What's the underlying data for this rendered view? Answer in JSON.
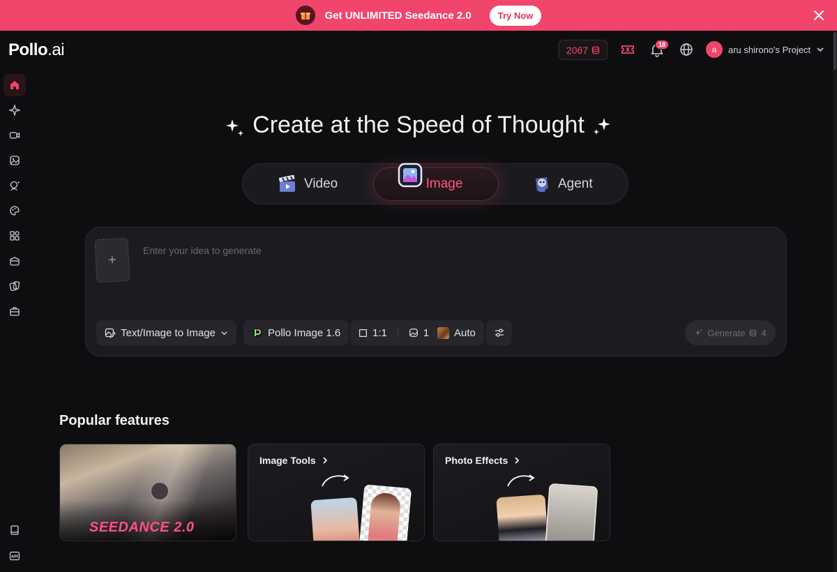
{
  "banner": {
    "text": "Get UNLIMITED Seedance 2.0",
    "cta": "Try Now"
  },
  "header": {
    "logo_main": "Pollo",
    "logo_suffix": ".ai",
    "credits": "2067",
    "notifications_count": "18",
    "avatar_letter": "a",
    "project_name": "aru shirono's Project"
  },
  "sidebar": {
    "icons": [
      "home-icon",
      "sparkle-icon",
      "video-icon",
      "image-icon",
      "avatar-icon",
      "palette-icon",
      "apps-icon",
      "layers-icon",
      "cards-icon",
      "toolbox-icon",
      "book-icon",
      "api-icon"
    ],
    "api_label": "API"
  },
  "hero": {
    "title": "Create at the Speed of Thought"
  },
  "modes": [
    {
      "label": "Video",
      "active": false
    },
    {
      "label": "Image",
      "active": true
    },
    {
      "label": "Agent",
      "active": false
    }
  ],
  "prompt": {
    "upload_symbol": "+",
    "placeholder": "Enter your idea to generate",
    "value": ""
  },
  "toolbar": {
    "mode_select": "Text/Image to Image",
    "model": "Pollo Image 1.6",
    "aspect_ratio": "1:1",
    "count": "1",
    "style": "Auto",
    "generate_label": "Generate",
    "generate_cost": "4"
  },
  "popular": {
    "title": "Popular features",
    "cards": [
      {
        "label": "SEEDANCE 2.0"
      },
      {
        "label": "Image Tools"
      },
      {
        "label": "Photo Effects"
      }
    ]
  },
  "colors": {
    "accent": "#f2456b",
    "background": "#0e0e11",
    "card": "#1b1b20"
  }
}
